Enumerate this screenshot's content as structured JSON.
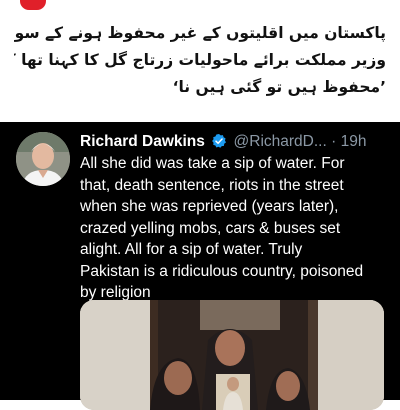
{
  "article": {
    "urdu_lines": [
      "پاکستان میں اقلیتوں کے غیر محفوظ ہونے کے سوال پر",
      "وزیر مملکت برائے ماحولیات زرتاج گل کا کہنا تھا کہ،",
      "’محفوظ ہیں تو گئی ہیں نا‘"
    ]
  },
  "tweet": {
    "author_name": "Richard Dawkins",
    "handle": "@RichardD...",
    "separator": "·",
    "time": "19h",
    "text_lines": [
      "All she did was take a sip of water. For",
      "that, death sentence, riots in the street",
      "when she was reprieved (years later),",
      "crazed yelling mobs, cars & buses set",
      "alight. All for a sip of water. Truly",
      "Pakistan is a ridiculous country, poisoned",
      "by religion"
    ],
    "verified_icon": "verified-badge-icon",
    "photo_description_icon": "tweet-photo"
  },
  "colors": {
    "tweet_background": "#000000",
    "tweet_text": "#ffffff",
    "secondary_text": "#8b98a5",
    "verified_blue": "#1d9bf0",
    "top_red": "#e0202a"
  }
}
